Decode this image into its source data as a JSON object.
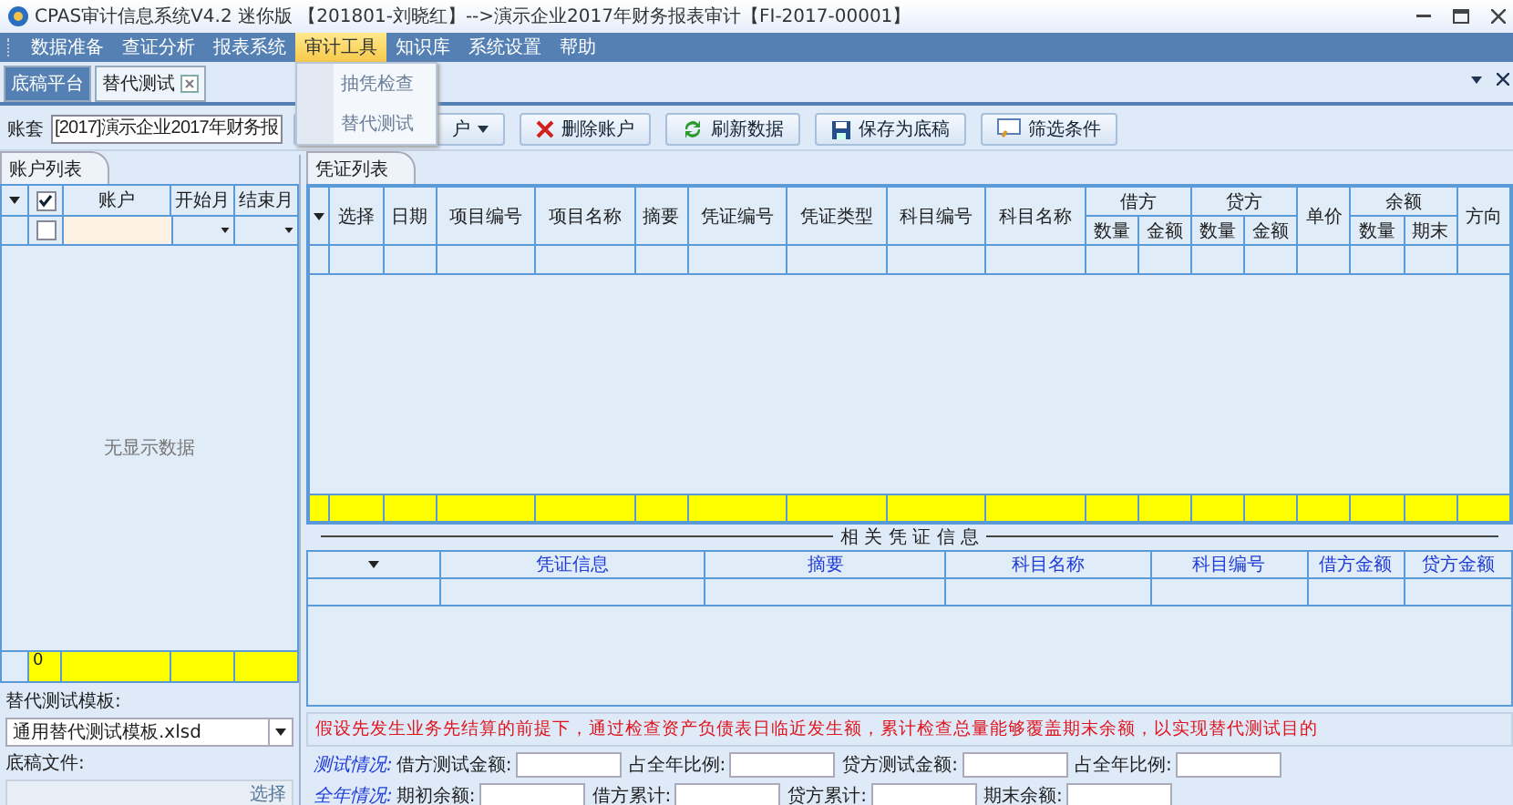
{
  "window": {
    "title": "CPAS审计信息系统V4.2 迷你版 【201801-刘晓红】-->演示企业2017年财务报表审计【FI-2017-00001】"
  },
  "menu": [
    {
      "label": "数据准备",
      "selected": false
    },
    {
      "label": "查证分析",
      "selected": false
    },
    {
      "label": "报表系统",
      "selected": false
    },
    {
      "label": "审计工具",
      "selected": true
    },
    {
      "label": "知识库",
      "selected": false
    },
    {
      "label": "系统设置",
      "selected": false
    },
    {
      "label": "帮助",
      "selected": false
    }
  ],
  "open_menu": [
    "抽凭检查",
    "替代测试"
  ],
  "doc_tabs": [
    {
      "label": "底稿平台",
      "selected": true,
      "closable": false
    },
    {
      "label": "替代测试",
      "selected": false,
      "closable": true
    }
  ],
  "account_set": {
    "label": "账套",
    "value": "[2017]演示企业2017年财务报"
  },
  "toolbar": [
    {
      "label": "户",
      "kind": "dropdown"
    },
    {
      "label": "删除账户",
      "kind": "delete"
    },
    {
      "label": "刷新数据",
      "kind": "refresh"
    },
    {
      "label": "保存为底稿",
      "kind": "save"
    },
    {
      "label": "筛选条件",
      "kind": "filter"
    }
  ],
  "account_panel": {
    "tab": "账户列表",
    "header_checked": true,
    "filter_checked": false,
    "columns": [
      "账户",
      "开始月",
      "结束月"
    ],
    "empty_text": "无显示数据",
    "footer_count": "0"
  },
  "template": {
    "label": "替代测试模板:",
    "value": "通用替代测试模板.xlsd",
    "file_label": "底稿文件:",
    "choose": "选择"
  },
  "voucher_panel": {
    "tab": "凭证列表",
    "columns": [
      {
        "label": "选择"
      },
      {
        "label": "日期"
      },
      {
        "label": "项目编号"
      },
      {
        "label": "项目名称"
      },
      {
        "label": "摘要"
      },
      {
        "label": "凭证编号"
      },
      {
        "label": "凭证类型"
      },
      {
        "label": "科目编号"
      },
      {
        "label": "科目名称"
      },
      {
        "label": "借方",
        "children": [
          "数量",
          "金额"
        ]
      },
      {
        "label": "贷方",
        "children": [
          "数量",
          "金额"
        ]
      },
      {
        "label": "单价"
      },
      {
        "label": "余额",
        "children": [
          "数量",
          "期末"
        ]
      },
      {
        "label": "方向"
      }
    ]
  },
  "related": {
    "title": "相 关 凭 证 信 息",
    "columns": [
      "凭证信息",
      "摘要",
      "科目名称",
      "科目编号",
      "借方金额",
      "贷方金额"
    ]
  },
  "notice": "假设先发生业务先结算的前提下，通过检查资产负债表日临近发生额，累计检查总量能够覆盖期末余额，以实现替代测试目的",
  "form": [
    {
      "label": "测试情况:",
      "fields": [
        "借方测试金额:",
        "占全年比例:",
        "贷方测试金额:",
        "占全年比例:"
      ]
    },
    {
      "label": "全年情况:",
      "fields": [
        "期初余额:",
        "借方累计:",
        "贷方累计:",
        "期末余额:"
      ]
    }
  ]
}
